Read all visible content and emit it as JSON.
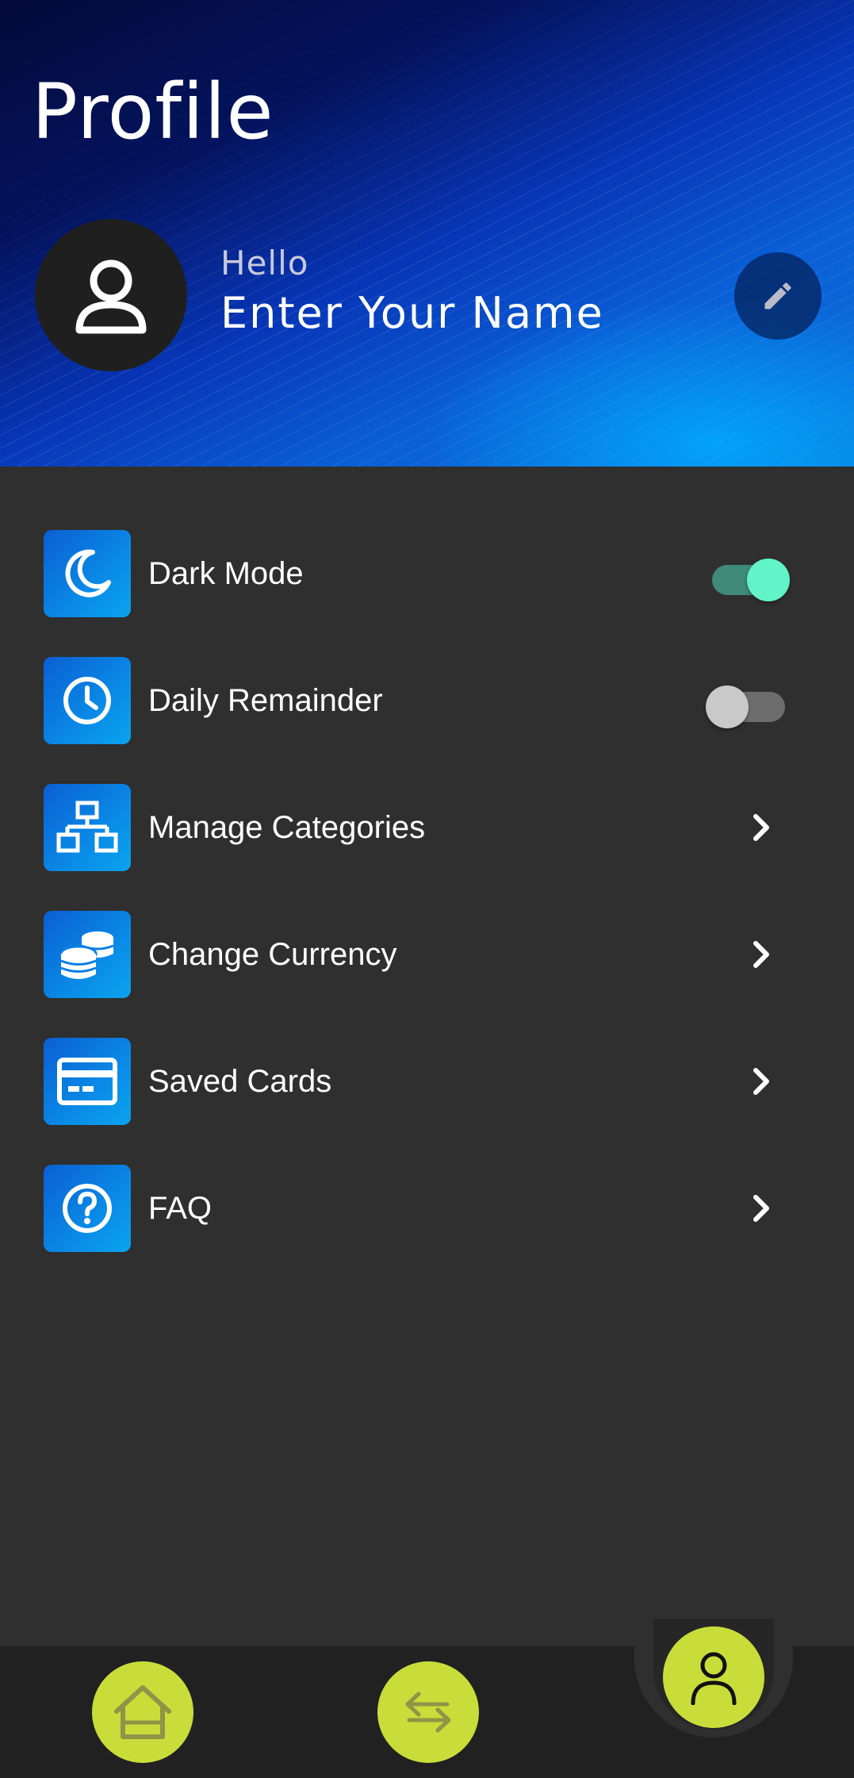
{
  "header": {
    "title": "Profile",
    "greeting": "Hello",
    "name": "Enter Your Name"
  },
  "settings": [
    {
      "label": "Dark Mode",
      "icon": "moon-icon",
      "control": "toggle",
      "enabled": true
    },
    {
      "label": "Daily Remainder",
      "icon": "clock-icon",
      "control": "toggle",
      "enabled": false
    },
    {
      "label": "Manage Categories",
      "icon": "sitemap-icon",
      "control": "chevron"
    },
    {
      "label": "Change Currency",
      "icon": "coins-icon",
      "control": "chevron"
    },
    {
      "label": "Saved Cards",
      "icon": "credit-card-icon",
      "control": "chevron"
    },
    {
      "label": "FAQ",
      "icon": "question-circle-icon",
      "control": "chevron"
    }
  ],
  "bottom_nav": [
    {
      "name": "home",
      "icon": "home-icon",
      "active": false
    },
    {
      "name": "transactions",
      "icon": "swap-arrows-icon",
      "active": false
    },
    {
      "name": "profile",
      "icon": "user-icon",
      "active": true
    }
  ],
  "colors": {
    "accent_yellow": "#c9dd3a",
    "toggle_on": "#62f3c8",
    "icon_blue": "#0a8ae6",
    "background": "#2f2f2f"
  }
}
